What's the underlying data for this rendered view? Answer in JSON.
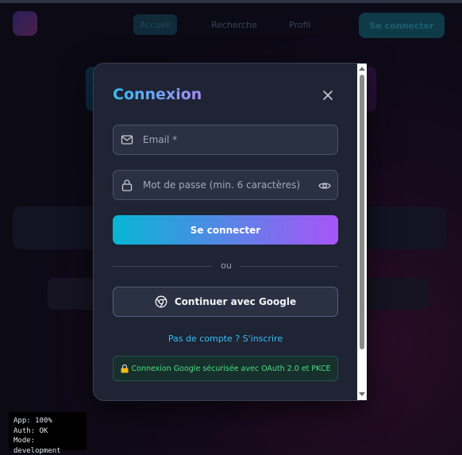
{
  "background": {
    "nav_links": [
      "Accueil",
      "Recherche",
      "Profil"
    ],
    "cta_label": "Se connecter"
  },
  "modal": {
    "title": "Connexion",
    "close_icon": "close-icon",
    "email_placeholder": "Email *",
    "password_placeholder": "Mot de passe (min. 6 caractères) *",
    "submit_label": "Se connecter",
    "divider_text": "ou",
    "google_label": "Continuer avec Google",
    "signup_link": "Pas de compte ? S'inscrire",
    "secure_note": "Connexion Google sécurisée avec OAuth 2.0 et PKCE"
  },
  "debug": {
    "app": "App: 100%",
    "auth": "Auth: OK",
    "mode": "Mode: development"
  },
  "colors": {
    "accent_start": "#06b6d4",
    "accent_end": "#a855f7",
    "link": "#38bdf8",
    "success": "#4ade80"
  }
}
